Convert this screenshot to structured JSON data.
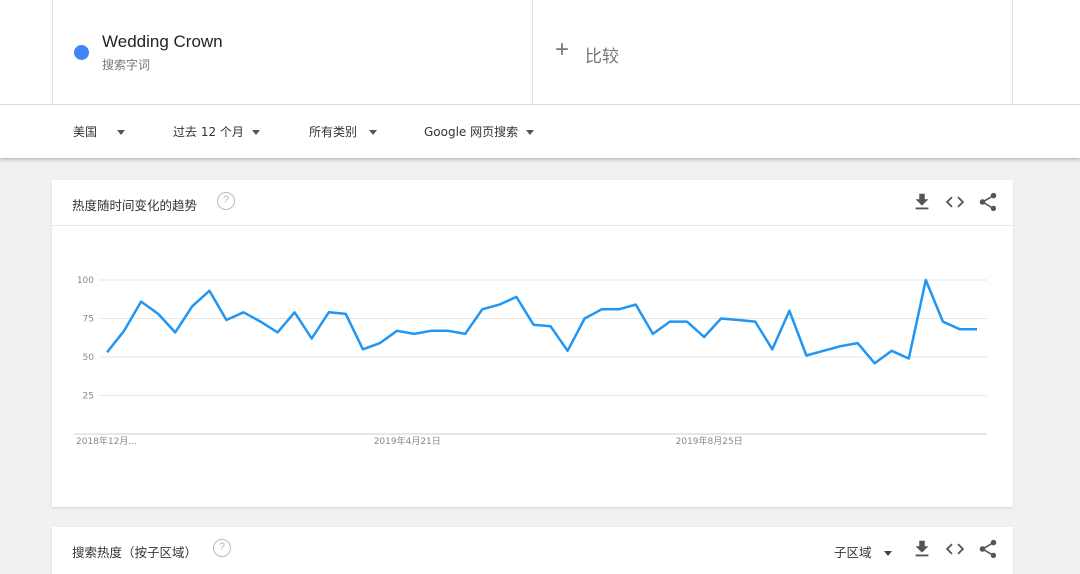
{
  "search_term": {
    "name": "Wedding Crown",
    "type": "搜索字词",
    "color": "#4285f4"
  },
  "compare": {
    "plus": "+",
    "label": "比较"
  },
  "filters": {
    "region": "美国",
    "time": "过去 12 个月",
    "category": "所有类别",
    "search_type": "Google 网页搜索"
  },
  "interest_card": {
    "title": "热度随时间变化的趋势"
  },
  "region_card": {
    "title": "搜索热度（按子区域）",
    "subregion_select": "子区域"
  },
  "icons": [
    "help-icon",
    "download-icon",
    "embed-icon",
    "share-icon",
    "chevron-down-icon"
  ],
  "chart_data": {
    "type": "line",
    "title": "",
    "xlabel": "",
    "ylabel": "",
    "ylim": [
      0,
      100
    ],
    "yticks": [
      25,
      50,
      75,
      100
    ],
    "x_tick_labels": [
      "2018年12月...",
      "2019年4月21日",
      "2019年8月25日"
    ],
    "grid": true,
    "line_color": "#2196f3",
    "series": [
      {
        "values": [
          53,
          67,
          86,
          78,
          66,
          83,
          93,
          74,
          79,
          73,
          66,
          79,
          62,
          79,
          78,
          55,
          59,
          67,
          65,
          67,
          67,
          65,
          81,
          84,
          89,
          71,
          70,
          54,
          75,
          81,
          81,
          84,
          65,
          73,
          73,
          63,
          75,
          74,
          73,
          55,
          80,
          51,
          54,
          57,
          59,
          46,
          54,
          49,
          100,
          73,
          68,
          68
        ]
      }
    ]
  }
}
